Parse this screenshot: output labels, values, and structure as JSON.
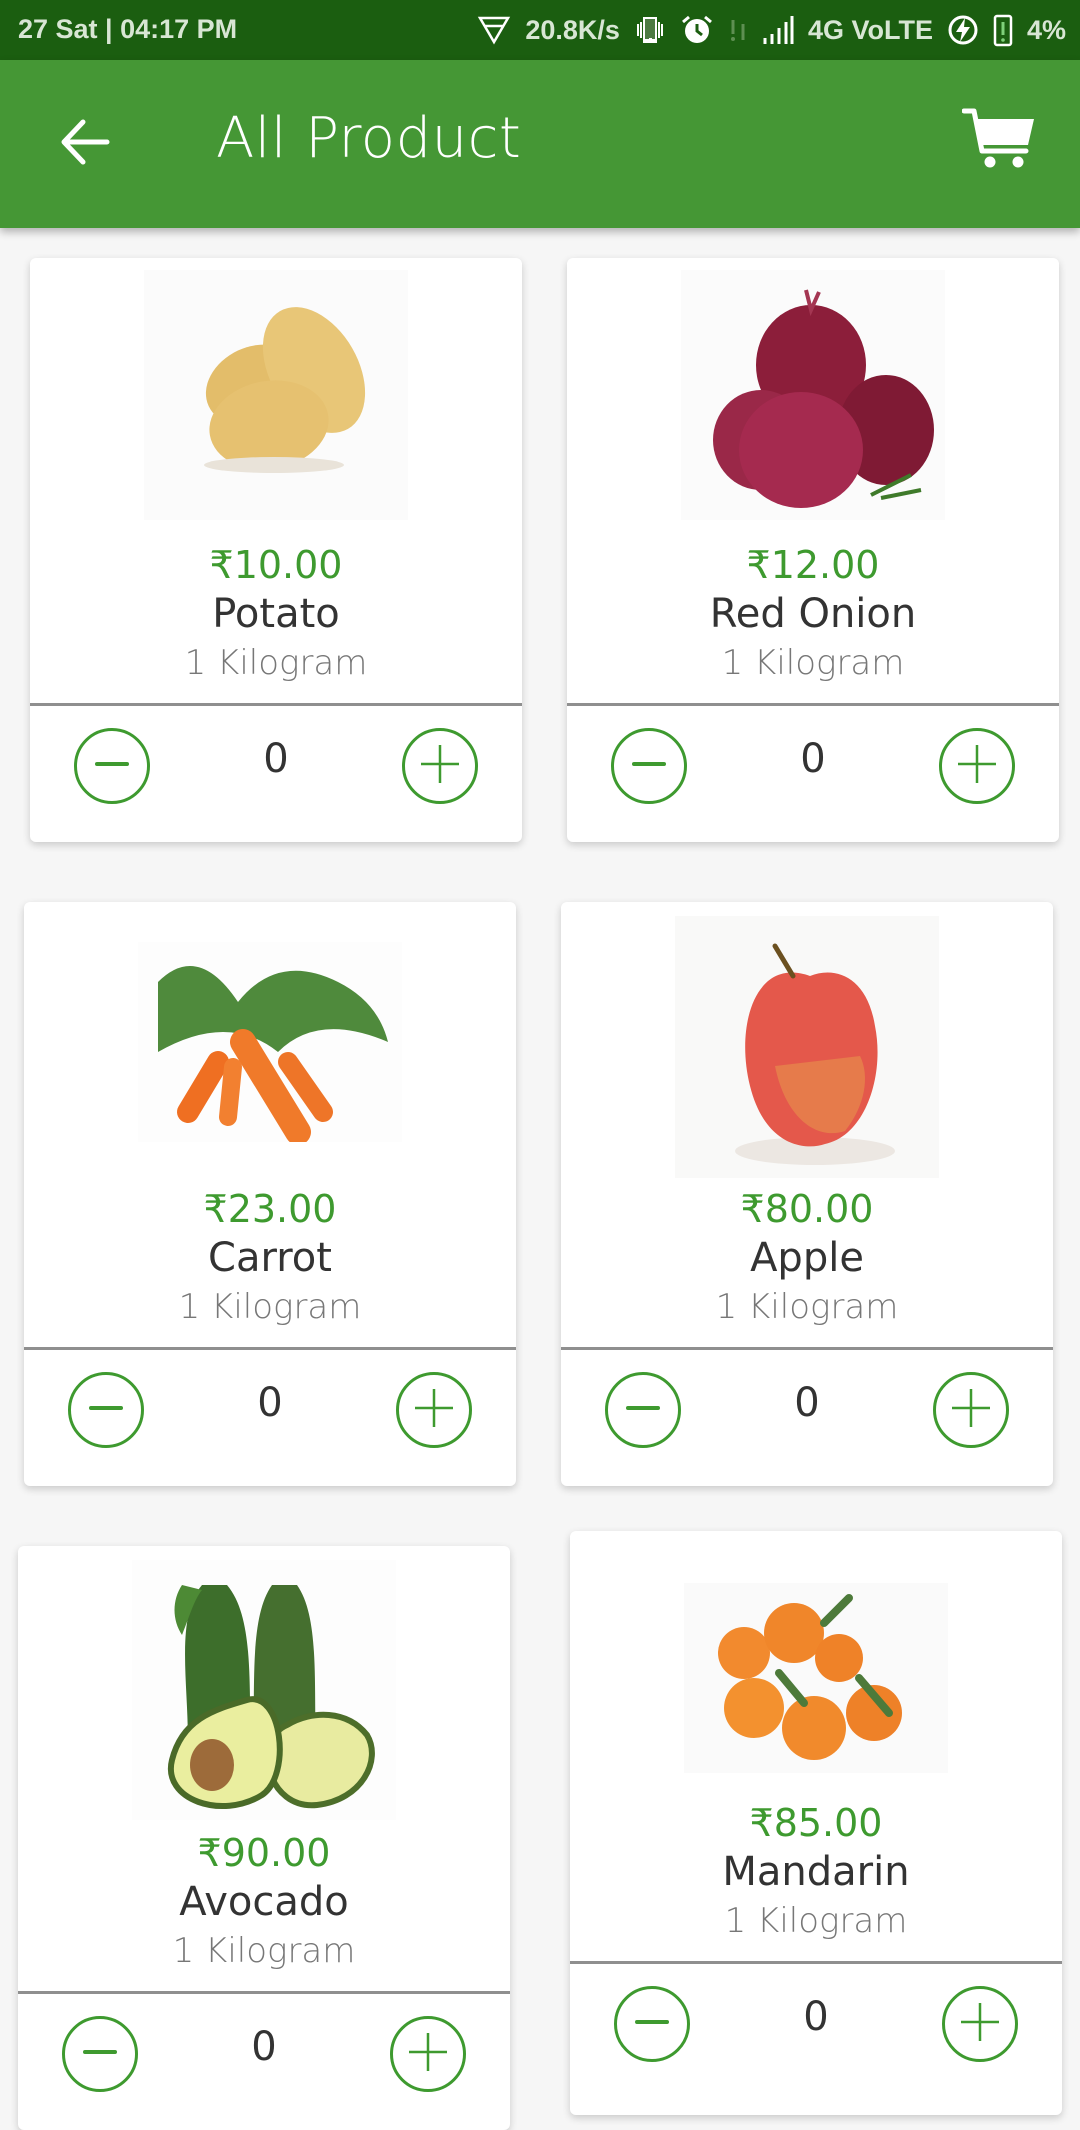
{
  "status_bar": {
    "datetime": "27 Sat | 04:17 PM",
    "net_speed": "20.8K/s",
    "network": "4G VoLTE",
    "battery": "4%",
    "icons": [
      "vpn-triangle-icon",
      "vibrate-icon",
      "alarm-icon",
      "no-sim-icon",
      "signal-icon",
      "charging-icon",
      "battery-icon"
    ]
  },
  "app_bar": {
    "title": "All Product",
    "back_icon": "arrow-left-icon",
    "cart_icon": "shopping-cart-icon"
  },
  "colors": {
    "status_bar": "#1b5e10",
    "app_bar": "#459735",
    "accent": "#3e9a2f",
    "background": "#f6f6f6"
  },
  "products": [
    {
      "price": "₹10.00",
      "name": "Potato",
      "unit": "1 Kilogram",
      "quantity": "0",
      "image": "potato"
    },
    {
      "price": "₹12.00",
      "name": "Red Onion",
      "unit": "1 Kilogram",
      "quantity": "0",
      "image": "red-onion"
    },
    {
      "price": "₹23.00",
      "name": "Carrot",
      "unit": "1 Kilogram",
      "quantity": "0",
      "image": "carrot"
    },
    {
      "price": "₹80.00",
      "name": "Apple",
      "unit": "1 Kilogram",
      "quantity": "0",
      "image": "apple"
    },
    {
      "price": "₹90.00",
      "name": "Avocado",
      "unit": "1 Kilogram",
      "quantity": "0",
      "image": "avocado"
    },
    {
      "price": "₹85.00",
      "name": "Mandarin",
      "unit": "1 Kilogram",
      "quantity": "0",
      "image": "mandarin"
    }
  ]
}
